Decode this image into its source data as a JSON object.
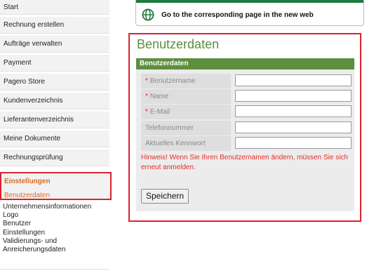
{
  "sidebar": {
    "items": [
      {
        "label": "Start"
      },
      {
        "label": "Rechnung erstellen"
      },
      {
        "label": "Aufträge verwalten"
      },
      {
        "label": "Payment"
      },
      {
        "label": "Pagero Store"
      },
      {
        "label": "Kundenverzeichnis"
      },
      {
        "label": "Lieferantenverzeichnis"
      },
      {
        "label": "Meine Dokumente"
      },
      {
        "label": "Rechnungsprüfung"
      }
    ],
    "settings": {
      "title": "Einstellungen",
      "active_sub": "Benutzerdaten",
      "sub_items": [
        {
          "label": "Unternehmensinformationen"
        },
        {
          "label": "Logo"
        },
        {
          "label": "Benutzer"
        },
        {
          "label": "Einstellungen"
        },
        {
          "label": "Validierungs- und"
        },
        {
          "label": "Anreicherungsdaten"
        }
      ]
    }
  },
  "banner": {
    "label": "Go to the corresponding page in the new web",
    "icon": "globe-icon"
  },
  "panel": {
    "title": "Benutzerdaten",
    "section_header": "Benutzerdaten",
    "fields": [
      {
        "required_mark": "*",
        "label": "Benutzername",
        "value": ""
      },
      {
        "required_mark": "*",
        "label": "Name",
        "value": ""
      },
      {
        "required_mark": "*",
        "label": "E-Mail",
        "value": ""
      },
      {
        "required_mark": "",
        "label": "Telefonnummer",
        "value": ""
      },
      {
        "required_mark": "",
        "label": "Aktuelles Kennwort",
        "value": ""
      }
    ],
    "hint": "Hinweis! Wenn Sie Ihren Benutzernamen ändern, müssen Sie sich erneut anmelden.",
    "save_label": "Speichern"
  },
  "colors": {
    "accent_green": "#5d8f3e",
    "highlight_red": "#d9232d",
    "active_orange": "#d96a22"
  }
}
